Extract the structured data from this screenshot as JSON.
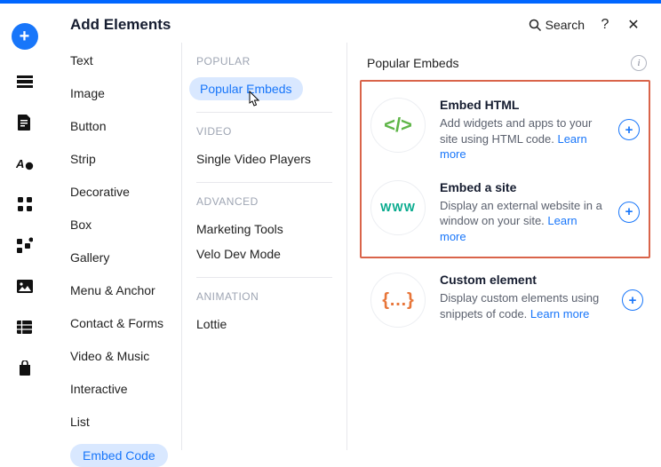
{
  "header": {
    "title": "Add Elements",
    "search": "Search",
    "help": "?",
    "close": "✕"
  },
  "categories": [
    "Text",
    "Image",
    "Button",
    "Strip",
    "Decorative",
    "Box",
    "Gallery",
    "Menu & Anchor",
    "Contact & Forms",
    "Video & Music",
    "Interactive",
    "List"
  ],
  "categories_selected": "Embed Code",
  "groups": [
    {
      "head": "POPULAR",
      "items": [
        {
          "label": "Popular Embeds",
          "active": true,
          "cursor": true
        }
      ]
    },
    {
      "head": "VIDEO",
      "items": [
        {
          "label": "Single Video Players"
        }
      ]
    },
    {
      "head": "ADVANCED",
      "items": [
        {
          "label": "Marketing Tools"
        },
        {
          "label": "Velo Dev Mode"
        }
      ]
    },
    {
      "head": "ANIMATION",
      "items": [
        {
          "label": "Lottie"
        }
      ]
    }
  ],
  "results": {
    "title": "Popular Embeds",
    "cards": [
      {
        "title": "Embed HTML",
        "desc": "Add widgets and apps to your site using HTML code.",
        "learn": "Learn more",
        "icon": "code"
      },
      {
        "title": "Embed a site",
        "desc": "Display an external website in a window on your site.",
        "learn": "Learn more",
        "icon": "www"
      },
      {
        "title": "Custom element",
        "desc": "Display custom elements using snippets of code.",
        "learn": "Learn more",
        "icon": "braces"
      }
    ]
  }
}
